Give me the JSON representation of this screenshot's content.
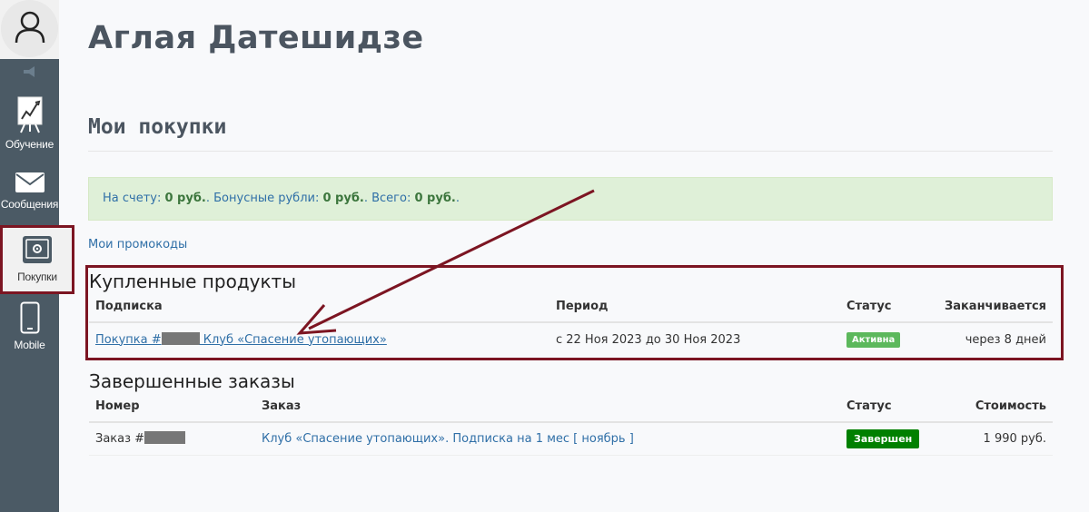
{
  "user_name": "Аглая Датешидзе",
  "sidebar": {
    "items": [
      {
        "label": "Обучение"
      },
      {
        "label": "Сообщения"
      },
      {
        "label": "Покупки"
      },
      {
        "label": "Mobile"
      }
    ]
  },
  "page": {
    "section_title": "Мои покупки",
    "balance": {
      "account_label": "На счету: ",
      "account_value": "0 руб.",
      "bonus_label": ". Бонусные рубли: ",
      "bonus_value": "0 руб.",
      "total_label": ". Всего: ",
      "total_value": "0 руб.",
      "end": "."
    },
    "promo_link": "Мои промокоды"
  },
  "bought": {
    "title": "Купленные продукты",
    "headers": [
      "Подписка",
      "Период",
      "Статус",
      "Заканчивается"
    ],
    "rows": [
      {
        "purchase_prefix": "Покупка #",
        "purchase_name": " Клуб «Спасение утопающих»",
        "period": "с 22 Ноя 2023 до 30 Ноя 2023",
        "status": "Активна",
        "ends": "через 8 дней"
      }
    ]
  },
  "completed": {
    "title": "Завершенные заказы",
    "headers": [
      "Номер",
      "Заказ",
      "Статус",
      "Стоимость"
    ],
    "rows": [
      {
        "number_prefix": "Заказ #",
        "order": "Клуб «Спасение утопающих». Подписка на 1 мес [ ноябрь ]",
        "status": "Завершен",
        "cost": "1 990 руб."
      }
    ]
  },
  "colors": {
    "sidebar": "#4b5a65",
    "annotation": "#7c1522",
    "link": "#2f6fa7",
    "badge_active": "#5cb85c",
    "badge_done": "#008000"
  }
}
